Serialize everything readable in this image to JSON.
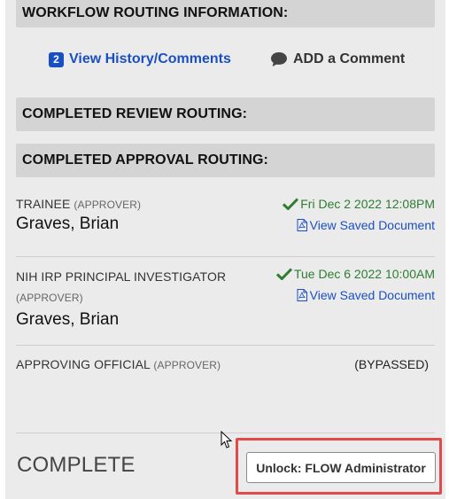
{
  "headers": {
    "workflow": "WORKFLOW ROUTING INFORMATION:",
    "review": "COMPLETED REVIEW ROUTING:",
    "approval": "COMPLETED APPROVAL ROUTING:"
  },
  "actions": {
    "history_count": "2",
    "history_label": "View History/Comments",
    "comment_label": "ADD a Comment",
    "comment_icon": "speech-bubble-icon"
  },
  "routing": [
    {
      "role": "TRAINEE",
      "qualifier": "(APPROVER)",
      "person": "Graves, Brian",
      "date": "Fri Dec 2 2022 12:08PM",
      "doc_link": "View Saved Document"
    },
    {
      "role": "NIH IRP PRINCIPAL INVESTIGATOR",
      "qualifier": "(APPROVER)",
      "person": "Graves, Brian",
      "date": "Tue Dec 6 2022 10:00AM",
      "doc_link": "View Saved Document"
    },
    {
      "role": "APPROVING OFFICIAL",
      "qualifier": "(APPROVER)",
      "status": "(BYPASSED)"
    }
  ],
  "footer": {
    "status": "COMPLETE",
    "unlock_label": "Unlock: FLOW Administrator"
  },
  "colors": {
    "link": "#1a4fc4",
    "success": "#2e7d32",
    "highlight": "#e04a4a",
    "panel": "#ebebeb",
    "header": "#d4d4d4"
  }
}
